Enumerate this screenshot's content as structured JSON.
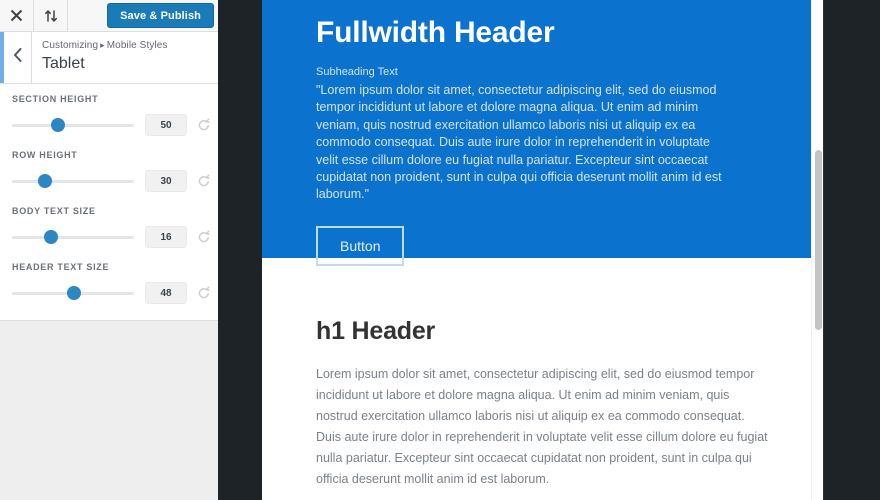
{
  "customizer": {
    "topbar": {
      "close_icon": "close-icon",
      "collapse_icon": "collapse-arrows-icon",
      "save_label": "Save & Publish",
      "accent_color": "#1a7bb9"
    },
    "header": {
      "back_icon": "chevron-left-icon",
      "breadcrumb_root": "Customizing",
      "breadcrumb_sep": "▸",
      "breadcrumb_section": "Mobile Styles",
      "panel_title": "Tablet"
    },
    "controls": [
      {
        "label": "Section Height",
        "value": "50",
        "slider_pct": 36,
        "reset_icon": "reset-icon"
      },
      {
        "label": "Row Height",
        "value": "30",
        "slider_pct": 24,
        "reset_icon": "reset-icon"
      },
      {
        "label": "Body Text Size",
        "value": "16",
        "slider_pct": 30,
        "reset_icon": "reset-icon"
      },
      {
        "label": "Header Text Size",
        "value": "48",
        "slider_pct": 51,
        "reset_icon": "reset-icon"
      }
    ]
  },
  "preview": {
    "hero": {
      "background_color": "#0b72ce",
      "title": "Fullwidth Header",
      "subheading": "Subheading Text",
      "body": "\"Lorem ipsum dolor sit amet, consectetur adipiscing elit, sed do eiusmod tempor incididunt ut labore et dolore magna aliqua. Ut enim ad minim veniam, quis nostrud exercitation ullamco laboris nisi ut aliquip ex ea commodo consequat. Duis aute irure dolor in reprehenderit in voluptate velit esse cillum dolore eu fugiat nulla pariatur. Excepteur sint occaecat cupidatat non proident, sunt in culpa qui officia deserunt mollit anim id est laborum.\"",
      "button_label": "Button"
    },
    "section": {
      "heading": "h1 Header",
      "body": "Lorem ipsum dolor sit amet, consectetur adipiscing elit, sed do eiusmod tempor incididunt ut labore et dolore magna aliqua. Ut enim ad minim veniam, quis nostrud exercitation ullamco laboris nisi ut aliquip ex ea commodo consequat. Duis aute irure dolor in reprehenderit in voluptate velit esse cillum dolore eu fugiat nulla pariatur. Excepteur sint occaecat cupidatat non proident, sunt in culpa qui officia deserunt mollit anim id est laborum."
    },
    "scrollbar": {
      "name": "preview-scrollbar"
    }
  }
}
